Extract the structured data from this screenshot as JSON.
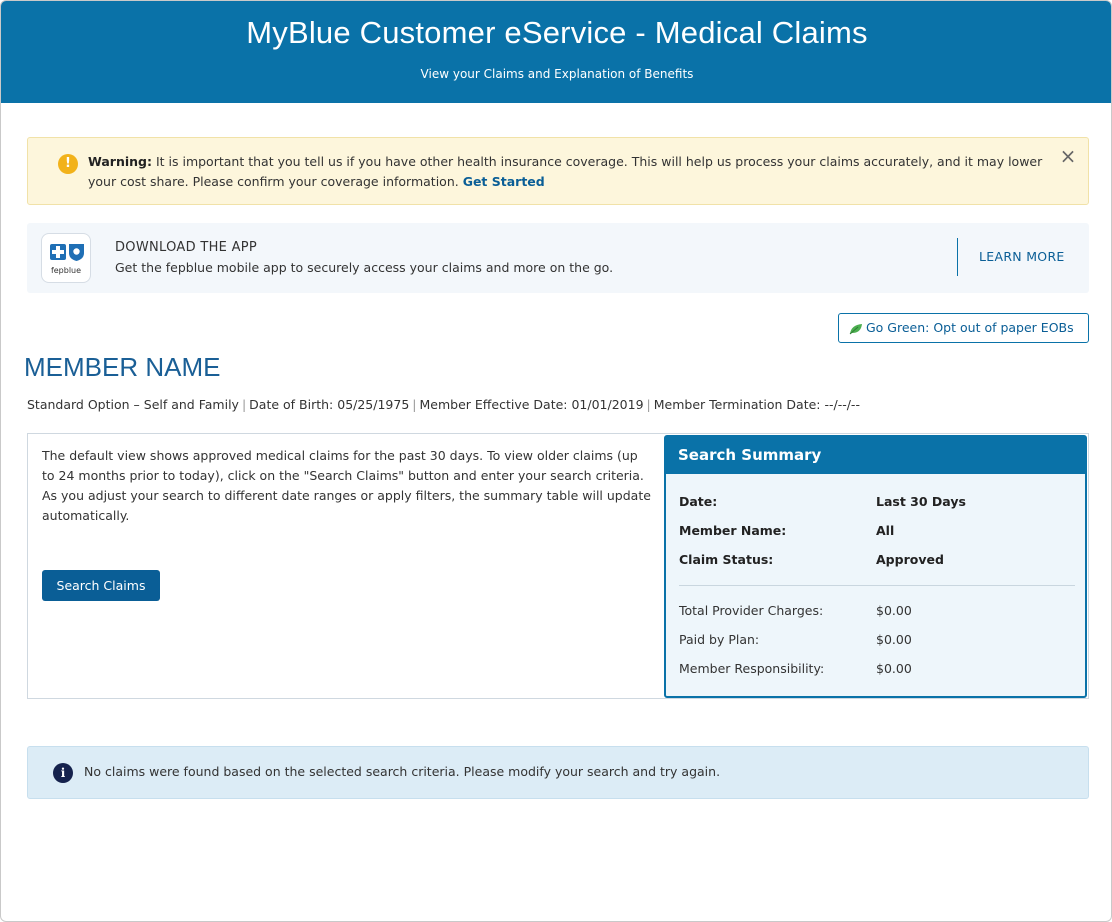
{
  "header": {
    "title": "MyBlue Customer eService - Medical Claims",
    "subtitle": "View your Claims and Explanation of Benefits"
  },
  "warning": {
    "label": "Warning:",
    "message": " It is important that you tell us if you have other health insurance coverage. This will help us process your claims accurately, and it may lower your cost share. Please confirm your coverage information. ",
    "link": "Get Started",
    "close": "×"
  },
  "app_banner": {
    "logo_text": "fepblue",
    "title": "DOWNLOAD THE APP",
    "description": "Get the fepblue mobile app to securely access your claims and more on the go.",
    "cta": "LEARN MORE"
  },
  "go_green": {
    "label": "Go Green: Opt out of paper EOBs"
  },
  "member": {
    "name": "MEMBER NAME",
    "plan": "Standard Option – Self and Family",
    "dob": "Date of Birth: 05/25/1975",
    "effective": "Member Effective Date: 01/01/2019",
    "termination": "Member Termination Date: --/--/--"
  },
  "panel": {
    "intro": "The default view shows approved medical claims for the past 30 days. To view older claims (up to 24 months prior to today), click on the \"Search Claims\" button and enter your search criteria. As you adjust your search to different date ranges or apply filters, the summary table will update automatically.",
    "search_button": "Search Claims"
  },
  "summary": {
    "title": "Search Summary",
    "filters": [
      {
        "label": "Date:",
        "value": "Last 30 Days"
      },
      {
        "label": "Member Name:",
        "value": "All"
      },
      {
        "label": "Claim Status:",
        "value": "Approved"
      }
    ],
    "totals": [
      {
        "label": "Total Provider Charges:",
        "value": "$0.00"
      },
      {
        "label": "Paid by Plan:",
        "value": "$0.00"
      },
      {
        "label": "Member Responsibility:",
        "value": "$0.00"
      }
    ]
  },
  "info": {
    "icon": "i",
    "message": "No claims were found based on the selected search criteria. Please modify your search and try again."
  },
  "colors": {
    "brand_blue": "#0a72a8",
    "link_blue": "#0a5e96",
    "warning_bg": "#fdf6dc",
    "warning_icon": "#f2b21a",
    "info_bg": "#dcecf6",
    "leaf_green": "#4caf50"
  },
  "icons": {
    "warning": "warning-icon",
    "close": "close-icon",
    "logo": "fepblue-logo-icon",
    "leaf": "leaf-icon",
    "info": "info-icon"
  }
}
